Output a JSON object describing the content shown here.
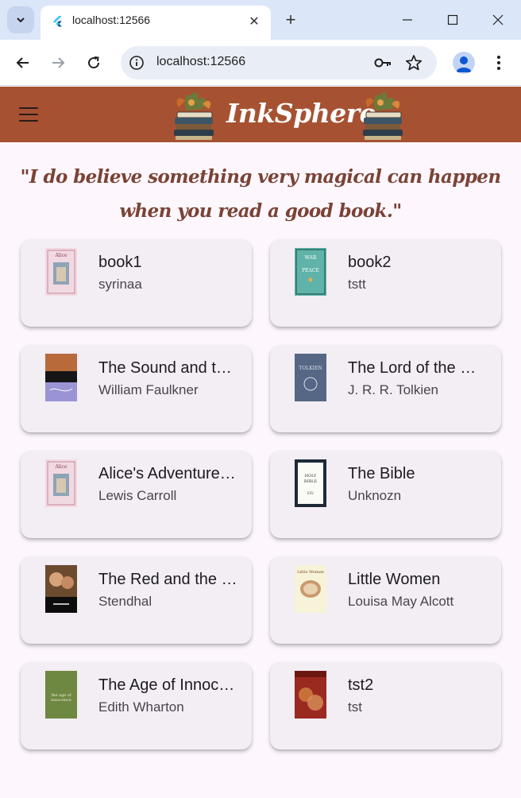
{
  "browser": {
    "tab_title": "localhost:12566",
    "url": "localhost:12566",
    "new_tab_symbol": "+",
    "close_symbol": "✕"
  },
  "app": {
    "brand": "InkSphere",
    "brand_color": "#a65232",
    "quote": "\"I do believe something very magical can happen when you read a good book.\""
  },
  "books": [
    {
      "title": "book1",
      "author": "syrinaa",
      "cover": "alice-cover"
    },
    {
      "title": "book2",
      "author": "tstt",
      "cover": "war-and-peace-cover"
    },
    {
      "title": "The Sound and the Fury",
      "author": " William Faulkner",
      "cover": "sound-and-fury-cover"
    },
    {
      "title": " The Lord of the Rings",
      "author": "J. R. R. Tolkien",
      "cover": "lord-of-the-rings-cover"
    },
    {
      "title": " Alice's Adventures in Wonderland",
      "author": " Lewis Carroll",
      "cover": "alice-cover"
    },
    {
      "title": "The Bible",
      "author": "Unknozn",
      "cover": "bible-cover"
    },
    {
      "title": "The Red and the Black",
      "author": "Stendhal",
      "cover": "red-and-black-cover"
    },
    {
      "title": "Little Women",
      "author": "Louisa May Alcott",
      "cover": "little-women-cover"
    },
    {
      "title": "The Age of Innocence",
      "author": "Edith Wharton",
      "cover": "age-of-innocence-cover"
    },
    {
      "title": "tst2",
      "author": "tst",
      "cover": "red-painting-cover"
    }
  ]
}
